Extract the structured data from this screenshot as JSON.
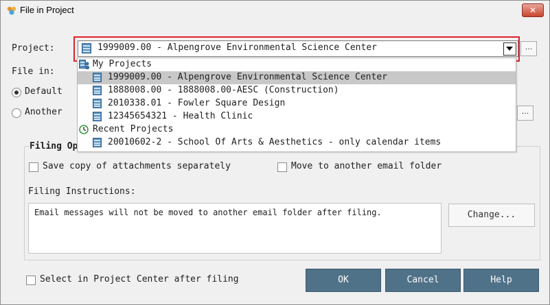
{
  "window": {
    "title": "File in Project",
    "close_label": "✕"
  },
  "project": {
    "label": "Project:",
    "selected": "1999009.00 - Alpengrove Environmental Science Center",
    "ellipsis": "..."
  },
  "file_in": {
    "label": "File in:",
    "default_label": "Default",
    "another_label": "Another",
    "ellipsis": "..."
  },
  "dropdown": {
    "my_projects_header": "My Projects",
    "my_projects": [
      "1999009.00 - Alpengrove Environmental Science Center",
      "1888008.00 - 1888008.00-AESC (Construction)",
      "2010338.01 - Fowler Square Design",
      "12345654321 - Health Clinic"
    ],
    "recent_projects_header": "Recent Projects",
    "recent_projects": [
      "20010602-2 - School Of Arts & Aesthetics - only calendar items"
    ],
    "selected_index": 0
  },
  "filing_options": {
    "title": "Filing Op",
    "save_copy_label": "Save copy of attachments separately",
    "move_label": "Move to another email folder",
    "instructions_label": "Filing Instructions:",
    "instructions_text": "Email messages will not be moved to another email folder after filing.",
    "change_label": "Change..."
  },
  "footer": {
    "select_after_label": "Select in Project Center after filing",
    "ok_label": "OK",
    "cancel_label": "Cancel",
    "help_label": "Help"
  },
  "colors": {
    "highlight_border": "#e0202a",
    "action_button": "#507289",
    "selected_row": "#c8c8c8"
  }
}
